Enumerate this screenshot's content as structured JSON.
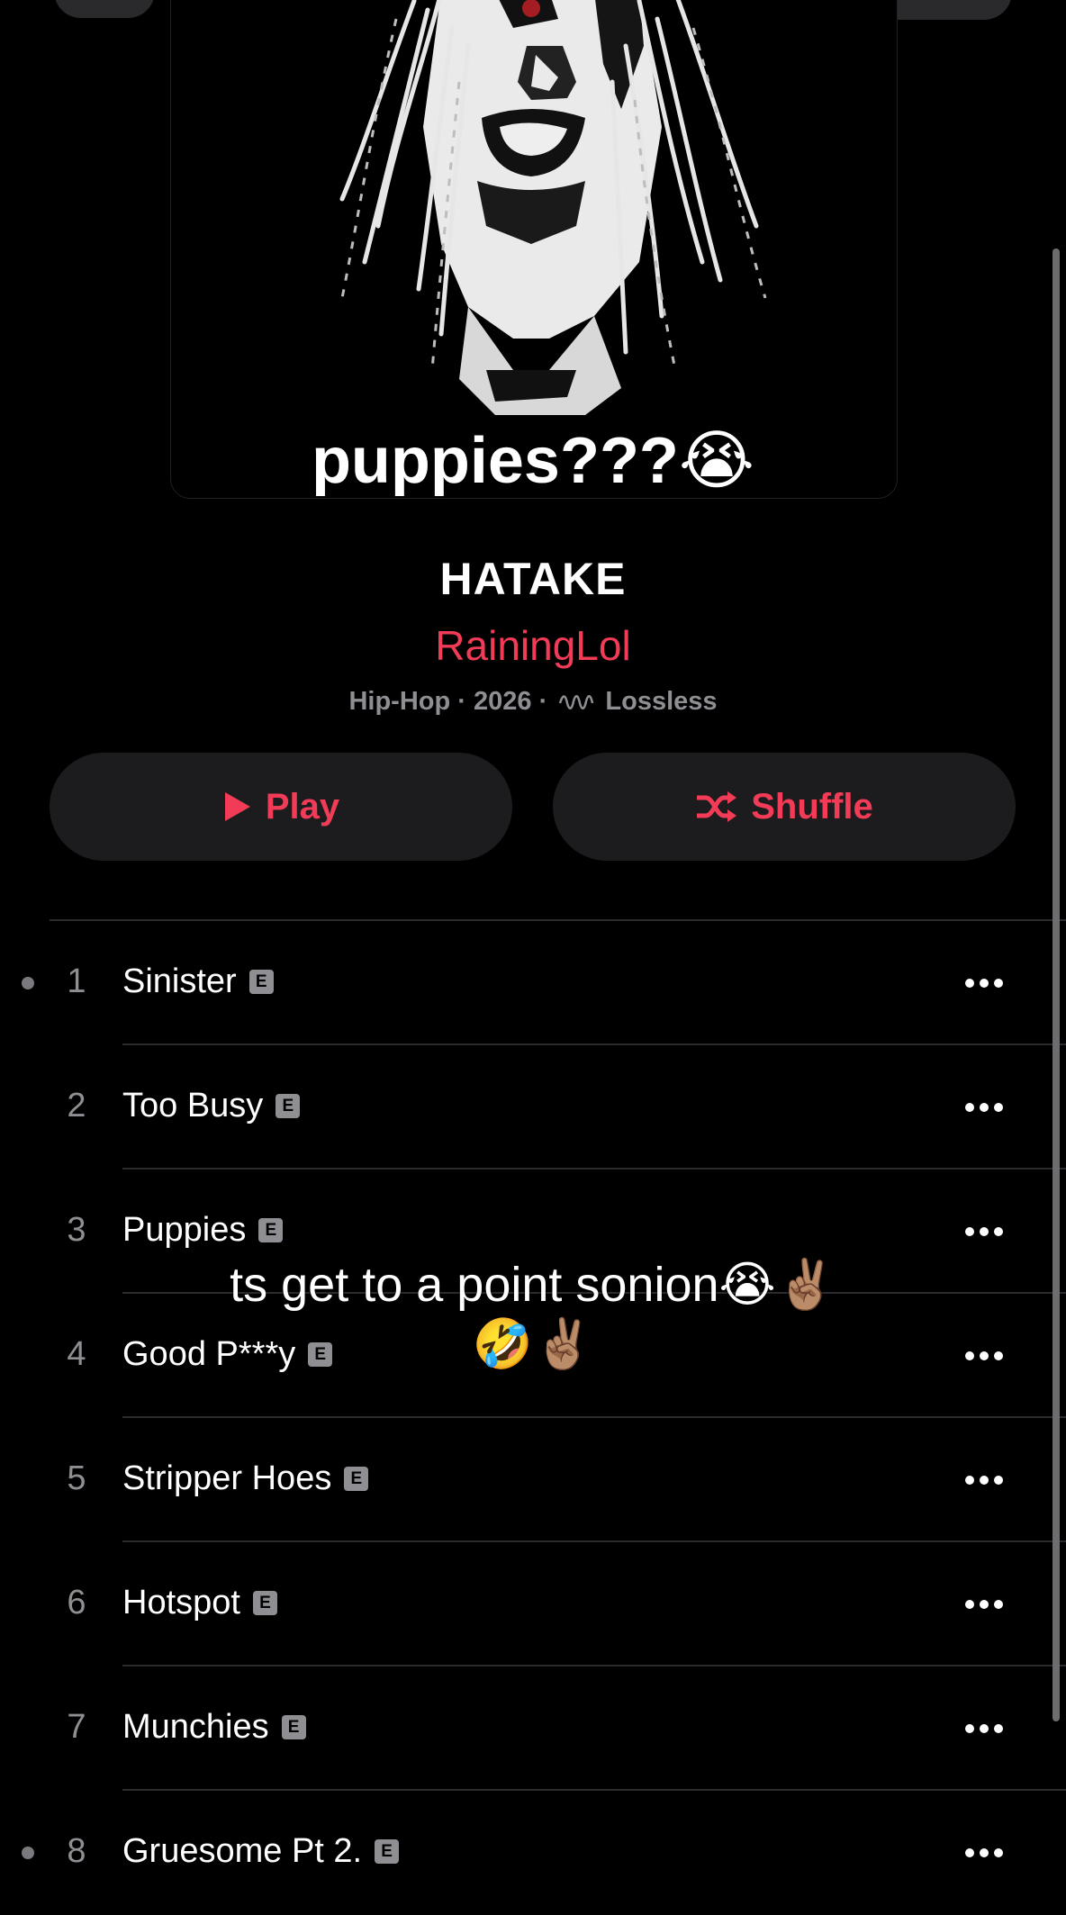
{
  "overlay": {
    "top_caption": "puppies???😭",
    "mid_caption_line1": "ts get to a point sonion😭✌🏽",
    "mid_caption_line2": "🤣✌🏽"
  },
  "album": {
    "title": "HATAKE",
    "artist": "RainingLol",
    "genre": "Hip-Hop",
    "year": "2026",
    "quality": "Lossless",
    "separator": "·"
  },
  "buttons": {
    "play_label": "Play",
    "shuffle_label": "Shuffle"
  },
  "tracks": [
    {
      "num": "1",
      "title": "Sinister",
      "explicit": "E",
      "marker": true
    },
    {
      "num": "2",
      "title": "Too Busy",
      "explicit": "E",
      "marker": false
    },
    {
      "num": "3",
      "title": "Puppies",
      "explicit": "E",
      "marker": false
    },
    {
      "num": "4",
      "title": "Good P***y",
      "explicit": "E",
      "marker": false
    },
    {
      "num": "5",
      "title": "Stripper Hoes",
      "explicit": "E",
      "marker": false
    },
    {
      "num": "6",
      "title": "Hotspot",
      "explicit": "E",
      "marker": false
    },
    {
      "num": "7",
      "title": "Munchies",
      "explicit": "E",
      "marker": false
    },
    {
      "num": "8",
      "title": "Gruesome Pt 2.",
      "explicit": "E",
      "marker": true
    }
  ],
  "colors": {
    "accent": "#f23c57",
    "background": "#000000",
    "button_bg": "#1c1c1e",
    "secondary_text": "#8e8e93"
  },
  "icons": {
    "play": "play-icon",
    "shuffle": "shuffle-icon",
    "more": "ellipsis-icon",
    "explicit": "explicit-icon",
    "lossless": "lossless-icon"
  }
}
